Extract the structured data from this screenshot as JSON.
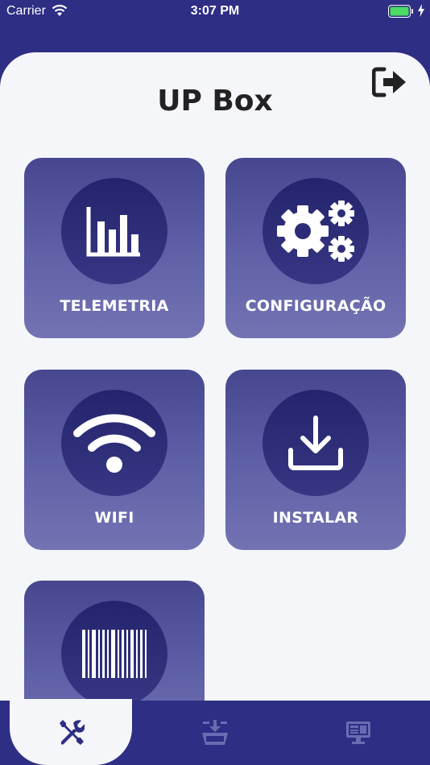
{
  "status_bar": {
    "carrier": "Carrier",
    "time": "3:07 PM",
    "battery_color": "#4cd964"
  },
  "header": {
    "title": "UP Box",
    "logout_icon": "sign-out-icon"
  },
  "tiles": [
    {
      "label": "TELEMETRIA",
      "icon": "bar-chart-icon"
    },
    {
      "label": "CONFIGURAÇÃO",
      "icon": "gears-icon"
    },
    {
      "label": "WIFI",
      "icon": "wifi-icon"
    },
    {
      "label": "INSTALAR",
      "icon": "download-icon"
    },
    {
      "label": "",
      "icon": "barcode-icon"
    }
  ],
  "tabbar": {
    "active_index": 0,
    "tabs": [
      {
        "icon": "tools-icon"
      },
      {
        "icon": "basket-download-icon"
      },
      {
        "icon": "monitor-icon"
      }
    ]
  },
  "colors": {
    "primary": "#2e2e85",
    "background": "#f5f6fa",
    "tile_top": "#47478f",
    "tile_bottom": "#7373b3"
  }
}
